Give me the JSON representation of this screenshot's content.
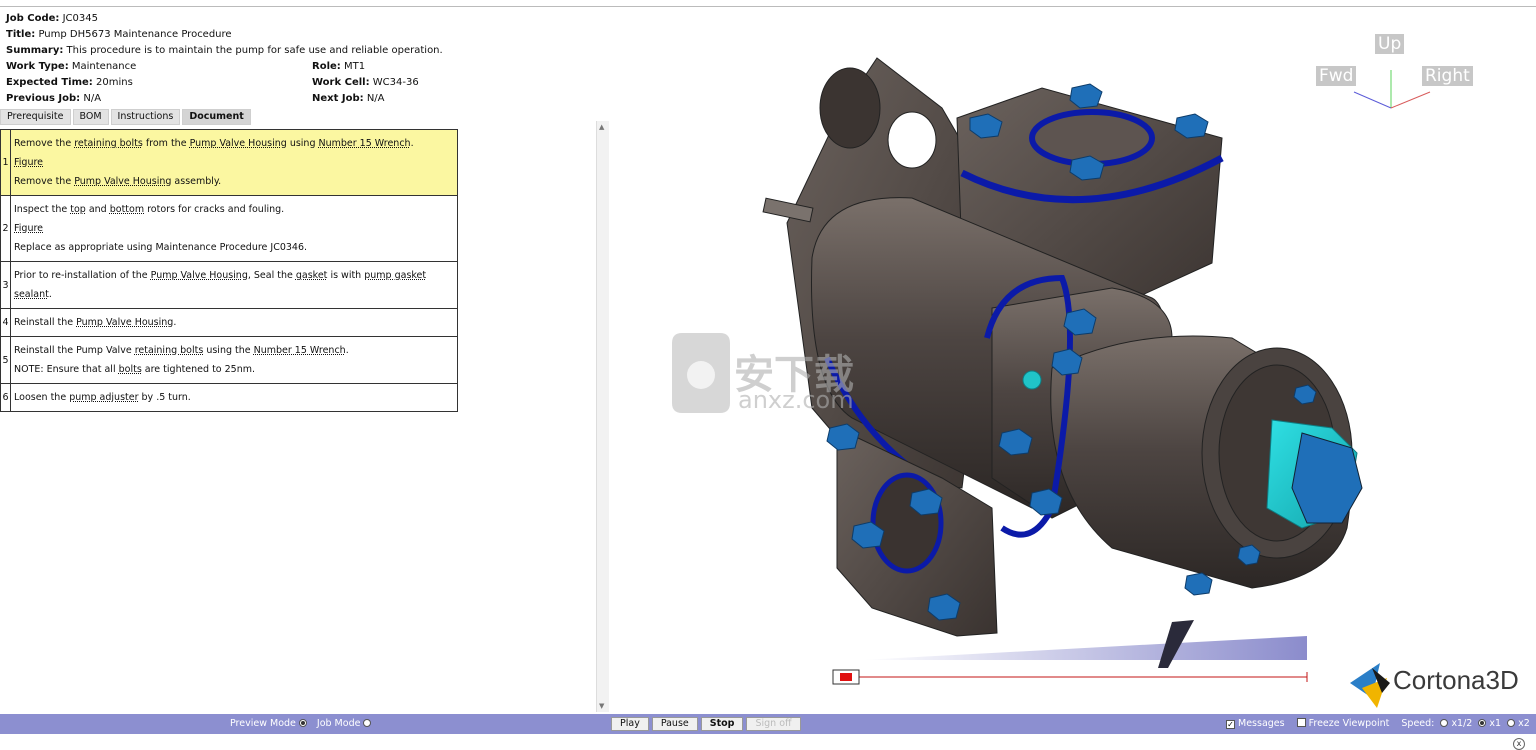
{
  "job": {
    "job_code_label": "Job Code:",
    "job_code": "JC0345",
    "title_label": "Title:",
    "title": "Pump DH5673 Maintenance Procedure",
    "summary_label": "Summary:",
    "summary": "This procedure is to maintain the pump for safe use and reliable operation.",
    "work_type_label": "Work Type:",
    "work_type": "Maintenance",
    "role_label": "Role:",
    "role": "MT1",
    "expected_time_label": "Expected Time:",
    "expected_time": "20mins",
    "work_cell_label": "Work Cell:",
    "work_cell": "WC34-36",
    "previous_job_label": "Previous Job:",
    "previous_job": "N/A",
    "next_job_label": "Next Job:",
    "next_job": "N/A"
  },
  "tabs": [
    "Prerequisite",
    "BOM",
    "Instructions",
    "Document"
  ],
  "active_tab": "Document",
  "steps": {
    "s1": {
      "num": "1",
      "a": "Remove the ",
      "a_u1": "retaining bolts",
      "a2": " from the ",
      "a_u2": "Pump Valve Housing",
      "a3": " using ",
      "a_u3": "Number 15 Wrench",
      "a4": ".",
      "figure": "Figure",
      "b": "Remove the ",
      "b_u": "Pump Valve Housing",
      "b2": " assembly."
    },
    "s2": {
      "num": "2",
      "a": "Inspect the ",
      "a_u1": "top",
      "a2": " and ",
      "a_u2": "bottom",
      "a3": " rotors for cracks and fouling.",
      "figure": "Figure",
      "b": "Replace as appropriate using Maintenance Procedure JC0346."
    },
    "s3": {
      "num": "3",
      "a": "Prior to re-installation of the ",
      "a_u1": "Pump Valve Housing",
      "a2": ", Seal the ",
      "a_u2": "gasket",
      "a3": " is with ",
      "a_u3": "pump gasket sealant",
      "a4": "."
    },
    "s4": {
      "num": "4",
      "a": "Reinstall the ",
      "a_u1": "Pump Valve Housing",
      "a2": "."
    },
    "s5": {
      "num": "5",
      "a": "Reinstall the Pump Valve ",
      "a_u1": "retaining bolts",
      "a2": " using the ",
      "a_u2": "Number 15 Wrench",
      "a3": ".",
      "b": "NOTE: Ensure that all ",
      "b_u": "bolts",
      "b2": " are tightened to 25nm."
    },
    "s6": {
      "num": "6",
      "a": "Loosen the ",
      "a_u1": "pump adjuster",
      "a2": " by .5 turn."
    }
  },
  "viewer": {
    "axis_up": "Up",
    "axis_fwd": "Fwd",
    "axis_right": "Right",
    "watermark_cn": "安下载",
    "watermark_url": "anxz.com",
    "brand": "Cortona3D",
    "colors": {
      "body": "#4a4340",
      "bolt": "#1f6fb8",
      "gasket": "#0b1aa8",
      "cap": "#20c4c8",
      "timeline": "#8b8ccc"
    }
  },
  "bottom": {
    "preview_mode": "Preview Mode",
    "job_mode": "Job Mode",
    "play": "Play",
    "pause": "Pause",
    "stop": "Stop",
    "sign_off": "Sign off",
    "messages": "Messages",
    "freeze_viewpoint": "Freeze Viewpoint",
    "speed": "Speed:",
    "speed_half": "x1/2",
    "speed_1": "x1",
    "speed_2": "x2",
    "help": "?",
    "close": "x"
  }
}
